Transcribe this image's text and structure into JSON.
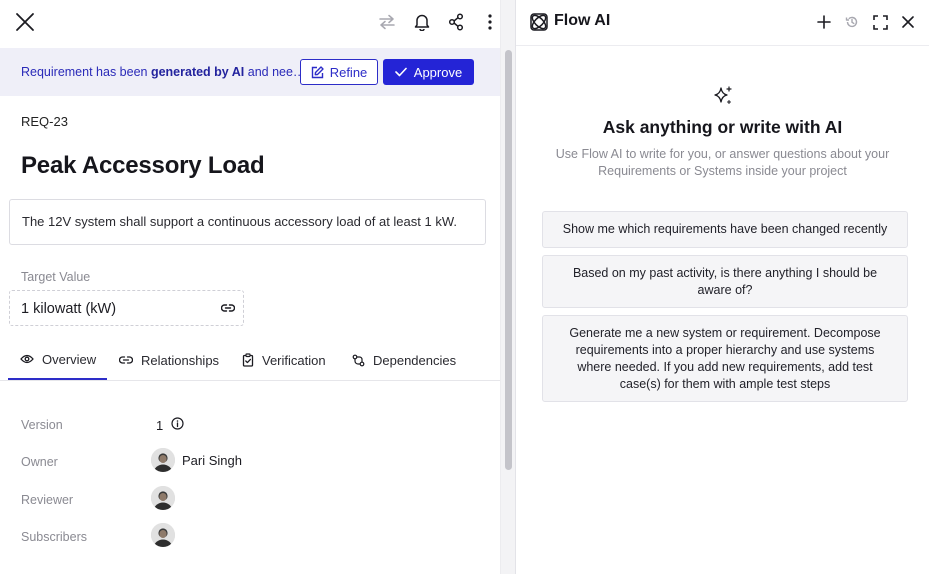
{
  "left": {
    "banner": {
      "text_prefix": "Requirement has been ",
      "text_bold": "generated by AI",
      "text_suffix": " and nee…",
      "refine_label": "Refine",
      "approve_label": "Approve"
    },
    "requirement": {
      "id": "REQ-23",
      "title": "Peak Accessory Load",
      "description": "The 12V system shall support a continuous accessory load of at least 1 kW.",
      "target_value_label": "Target Value",
      "target_value": "1 kilowatt (kW)"
    },
    "tabs": [
      {
        "label": "Overview",
        "icon": "eye-icon",
        "active": true
      },
      {
        "label": "Relationships",
        "icon": "link-icon",
        "active": false
      },
      {
        "label": "Verification",
        "icon": "clipboard-check-icon",
        "active": false
      },
      {
        "label": "Dependencies",
        "icon": "dependency-icon",
        "active": false
      }
    ],
    "properties": {
      "version_label": "Version",
      "version_value": "1",
      "owner_label": "Owner",
      "owner_name": "Pari Singh",
      "reviewer_label": "Reviewer",
      "subscribers_label": "Subscribers"
    }
  },
  "right": {
    "title": "Flow AI",
    "ask_title": "Ask anything or write with AI",
    "ask_subtitle": "Use Flow AI to write for you, or answer questions about your Requirements or Systems inside your project",
    "suggestions": [
      "Show me which requirements have been changed recently",
      "Based on my past activity, is there anything I should be aware of?",
      "Generate me a new system or requirement. Decompose requirements into a proper hierarchy and use systems where needed. If you add new requirements, add test case(s) for them with ample test steps"
    ]
  },
  "colors": {
    "accent": "#2424d6",
    "banner_bg": "#efeff8",
    "banner_text": "#2a2ab8"
  }
}
